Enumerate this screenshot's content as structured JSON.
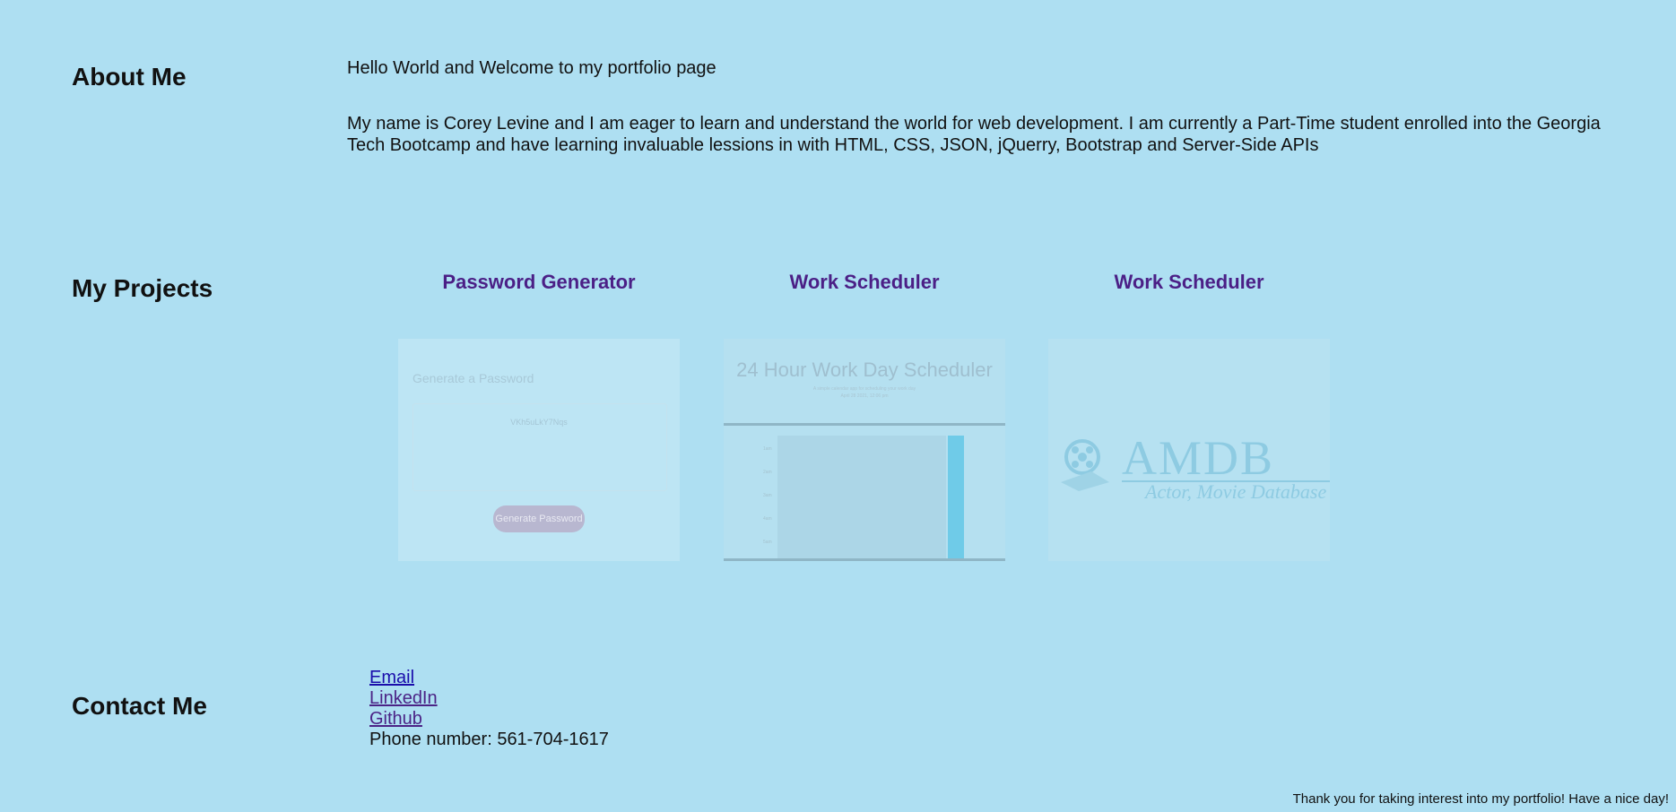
{
  "about": {
    "title": "About Me",
    "intro": "Hello World and Welcome to my portfolio page",
    "bio": "My name is Corey Levine and I am eager to learn and understand the world for web development. I am currently a Part-Time student enrolled into the Georgia Tech Bootcamp and have learning invaluable lessions in with HTML, CSS, JSON, jQuerry, Bootstrap and Server-Side APIs"
  },
  "projects": {
    "title": "My Projects",
    "items": [
      {
        "title": "Password Generator",
        "thumb_heading": "Generate a Password",
        "thumb_password": "VKh5uLkY7Nqs",
        "thumb_button": "Generate Password"
      },
      {
        "title": "Work Scheduler",
        "thumb_heading": "24 Hour Work Day Scheduler",
        "thumb_subtitle": "A simple calendar app for scheduling your work day",
        "thumb_date": "April 28 2021, 12:06 pm",
        "thumb_hours": [
          "1am",
          "2am",
          "3am",
          "4am",
          "5am",
          "6am"
        ]
      },
      {
        "title": "Work Scheduler",
        "thumb_logo": "AMDB",
        "thumb_logo_sub": "Actor, Movie Database"
      }
    ]
  },
  "contact": {
    "title": "Contact Me",
    "email": "Email",
    "linkedin": "LinkedIn",
    "github": "Github",
    "phone": "Phone number: 561-704-1617"
  },
  "footer": {
    "text": "Thank you for taking interest into my portfolio! Have a nice day!"
  },
  "colors": {
    "background": "#aedff2",
    "project_title": "#4b1f86",
    "link": "#1a0dab",
    "visited_link": "#4b2386"
  }
}
